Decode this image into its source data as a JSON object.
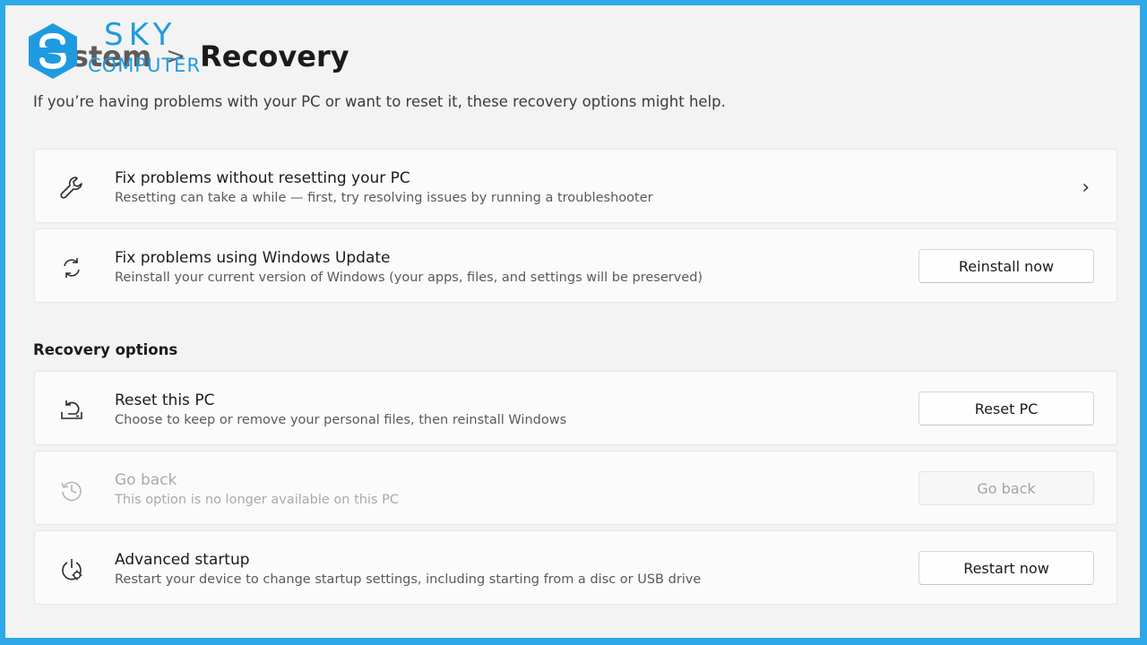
{
  "watermark": {
    "line1": "SKY",
    "line2": "COMPUTER",
    "color": "#1e9be0"
  },
  "header": {
    "breadcrumb_parent": "System",
    "separator": ">",
    "breadcrumb_current": "Recovery"
  },
  "subtitle": "If you’re having problems with your PC or want to reset it, these recovery options might help.",
  "cards": [
    {
      "icon": "wrench-icon",
      "title": "Fix problems without resetting your PC",
      "desc": "Resetting can take a while — first, try resolving issues by running a troubleshooter",
      "chevron": "›"
    },
    {
      "icon": "refresh-icon",
      "title": "Fix problems using Windows Update",
      "desc": "Reinstall your current version of Windows (your apps, files, and settings will be preserved)",
      "button": "Reinstall now"
    }
  ],
  "recovery_options": {
    "heading": "Recovery options",
    "items": [
      {
        "icon": "reset-pc-icon",
        "title": "Reset this PC",
        "desc": "Choose to keep or remove your personal files, then reinstall Windows",
        "button": "Reset PC",
        "disabled": false
      },
      {
        "icon": "history-icon",
        "title": "Go back",
        "desc": "This option is no longer available on this PC",
        "button": "Go back",
        "disabled": true
      },
      {
        "icon": "advanced-startup-icon",
        "title": "Advanced startup",
        "desc": "Restart your device to change startup settings, including starting from a disc or USB drive",
        "button": "Restart now",
        "disabled": false
      }
    ]
  },
  "colors": {
    "frame_border": "#2ea8e6",
    "background": "#f3f3f3",
    "card": "#fbfbfb"
  }
}
